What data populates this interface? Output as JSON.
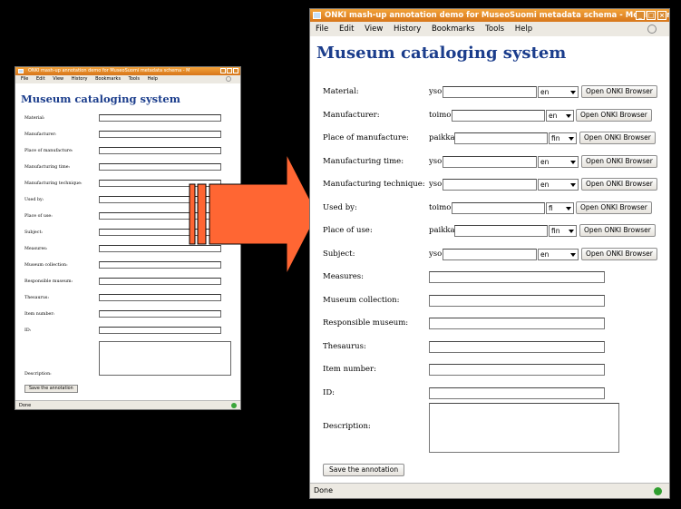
{
  "colors": {
    "title_text": "#1b3d8c",
    "titlebar": "#e08a2a",
    "arrow": "#ff6633",
    "status_ok": "#2f9e2f"
  },
  "small_window": {
    "title": "ONKI mash-up annotation demo for MuseoSuomi metadata schema - M",
    "menu": [
      "File",
      "Edit",
      "View",
      "History",
      "Bookmarks",
      "Tools",
      "Help"
    ],
    "heading": "Museum cataloging system",
    "labels": [
      "Material:",
      "Manufacturer:",
      "Place of manufacture:",
      "Manufacturing time:",
      "Manufacturing technique:",
      "Used by:",
      "Place of use:",
      "Subject:",
      "Measures:",
      "Museum collection:",
      "Responsible museum:",
      "Thesaurus:",
      "Item number:",
      "ID:"
    ],
    "description_label": "Description:",
    "save_label": "Save the annotation",
    "status": "Done"
  },
  "big_window": {
    "title": "ONKI mash-up annotation demo for MuseoSuomi metadata schema - Mozilla Fir",
    "menu": [
      "File",
      "Edit",
      "View",
      "History",
      "Bookmarks",
      "Tools",
      "Help"
    ],
    "heading": "Museum cataloging system",
    "onki_rows": [
      {
        "label": "Material:",
        "prefix": "yso",
        "lang": "en",
        "button": "Open ONKI Browser"
      },
      {
        "label": "Manufacturer:",
        "prefix": "toimo",
        "lang": "en",
        "button": "Open ONKI Browser"
      },
      {
        "label": "Place of manufacture:",
        "prefix": "paikka",
        "lang": "fin",
        "button": "Open ONKI Browser"
      },
      {
        "label": "Manufacturing time:",
        "prefix": "yso",
        "lang": "en",
        "button": "Open ONKI Browser"
      },
      {
        "label": "Manufacturing technique:",
        "prefix": "yso",
        "lang": "en",
        "button": "Open ONKI Browser"
      },
      {
        "label": "Used by:",
        "prefix": "toimo",
        "lang": "fi",
        "button": "Open ONKI Browser"
      },
      {
        "label": "Place of use:",
        "prefix": "paikka",
        "lang": "fin",
        "button": "Open ONKI Browser"
      },
      {
        "label": "Subject:",
        "prefix": "yso",
        "lang": "en",
        "button": "Open ONKI Browser"
      }
    ],
    "plain_rows": [
      "Measures:",
      "Museum collection:",
      "Responsible museum:",
      "Thesaurus:",
      "Item number:",
      "ID:"
    ],
    "description_label": "Description:",
    "save_label": "Save the annotation",
    "status": "Done"
  }
}
